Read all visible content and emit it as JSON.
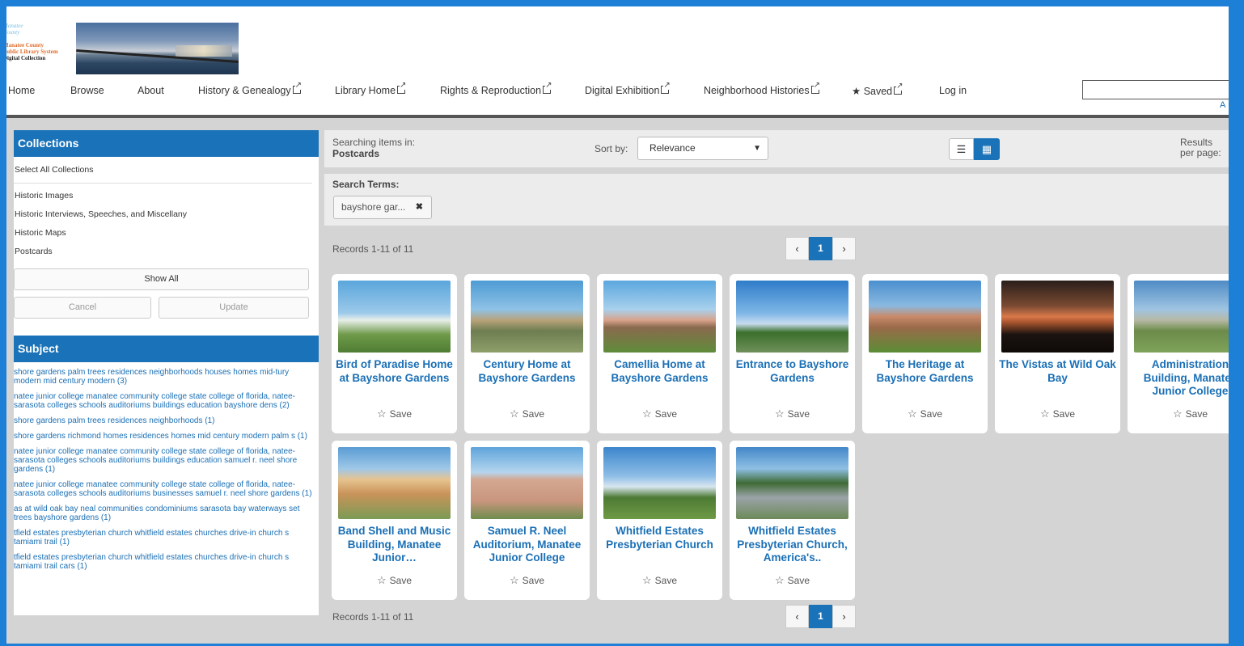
{
  "logo": {
    "line1": "Manatee",
    "line2": "County",
    "line3": "Manatee County",
    "line4": "Public Library System",
    "line5": "Digital Collection"
  },
  "nav": {
    "home": "Home",
    "browse": "Browse",
    "about": "About",
    "history": "History & Genealogy",
    "library_home": "Library Home",
    "rights": "Rights & Reproduction",
    "exhibition": "Digital Exhibition",
    "neighborhood": "Neighborhood Histories",
    "saved": "Saved",
    "login": "Log in",
    "advanced": "A"
  },
  "sidebar": {
    "collections_title": "Collections",
    "select_all": "Select All Collections",
    "collections": [
      "Historic Images",
      "Historic Interviews, Speeches, and Miscellany",
      "Historic Maps",
      "Postcards"
    ],
    "show_all": "Show All",
    "cancel": "Cancel",
    "update": "Update",
    "subject_title": "Subject",
    "subjects": [
      "shore gardens palm trees residences neighborhoods houses homes mid-tury modern mid century modern (3)",
      "natee junior college manatee community college state college of florida, natee-sarasota colleges schools auditoriums buildings education bayshore dens (2)",
      "shore gardens palm trees residences neighborhoods (1)",
      "shore gardens richmond homes residences homes mid century modern palm s (1)",
      "natee junior college manatee community college state college of florida, natee-sarasota colleges schools auditoriums buildings education samuel r. neel shore gardens (1)",
      "natee junior college manatee community college state college of florida, natee-sarasota colleges schools auditoriums businesses samuel r. neel shore gardens (1)",
      "as at wild oak bay neal communities condominiums sarasota bay waterways set trees bayshore gardens (1)",
      "tfield estates presbyterian church whitfield estates churches drive-in church s tamiami trail (1)",
      "tfield estates presbyterian church whitfield estates churches drive-in church s tamiami trail cars (1)"
    ]
  },
  "toolbar": {
    "searching_label": "Searching items in:",
    "searching_value": "Postcards",
    "sort_label": "Sort by:",
    "sort_value": "Relevance",
    "rpp_label": "Results per page:"
  },
  "terms": {
    "label": "Search Terms:",
    "chip": "bayshore gar..."
  },
  "pagination": {
    "records_text": "Records 1-11 of 11",
    "prev": "‹",
    "current": "1",
    "next": "›"
  },
  "cards": [
    {
      "title": "Bird of Paradise Home at Bayshore Gardens",
      "save": "Save"
    },
    {
      "title": "Century Home at Bayshore Gardens",
      "save": "Save"
    },
    {
      "title": "Camellia Home at Bayshore Gardens",
      "save": "Save"
    },
    {
      "title": "Entrance to Bayshore Gardens",
      "save": "Save"
    },
    {
      "title": "The Heritage at Bayshore Gardens",
      "save": "Save"
    },
    {
      "title": "The Vistas at Wild Oak Bay",
      "save": "Save"
    },
    {
      "title": "Administration Building, Manatee Junior College",
      "save": "Save"
    },
    {
      "title": "Band Shell and Music Building, Manatee Junior…",
      "save": "Save"
    },
    {
      "title": "Samuel R. Neel Auditorium, Manatee Junior College",
      "save": "Save"
    },
    {
      "title": "Whitfield Estates Presbyterian Church",
      "save": "Save"
    },
    {
      "title": "Whitfield Estates Presbyterian Church, America's..",
      "save": "Save"
    }
  ],
  "colors": {
    "frame": "#1e7fd6",
    "accent": "#1a73b8",
    "link": "#1a6fb5",
    "background": "#d4d4d4"
  }
}
